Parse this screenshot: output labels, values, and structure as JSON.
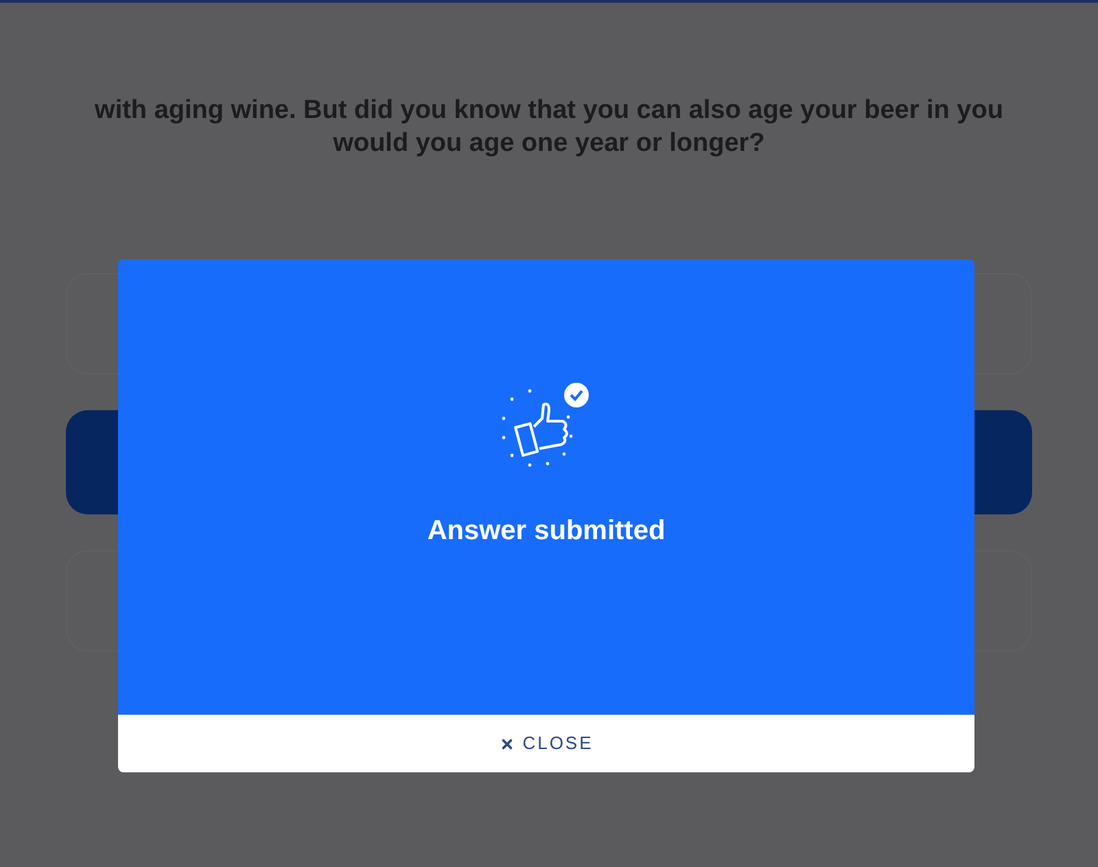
{
  "question": {
    "lines": [
      "with aging wine. But did you know that you can also age your beer in you",
      "would you age one year or longer?"
    ]
  },
  "options": [
    {
      "selected": false
    },
    {
      "selected": true
    },
    {
      "selected": false
    }
  ],
  "dialog": {
    "message": "Answer submitted",
    "close_button": "CLOSE"
  }
}
